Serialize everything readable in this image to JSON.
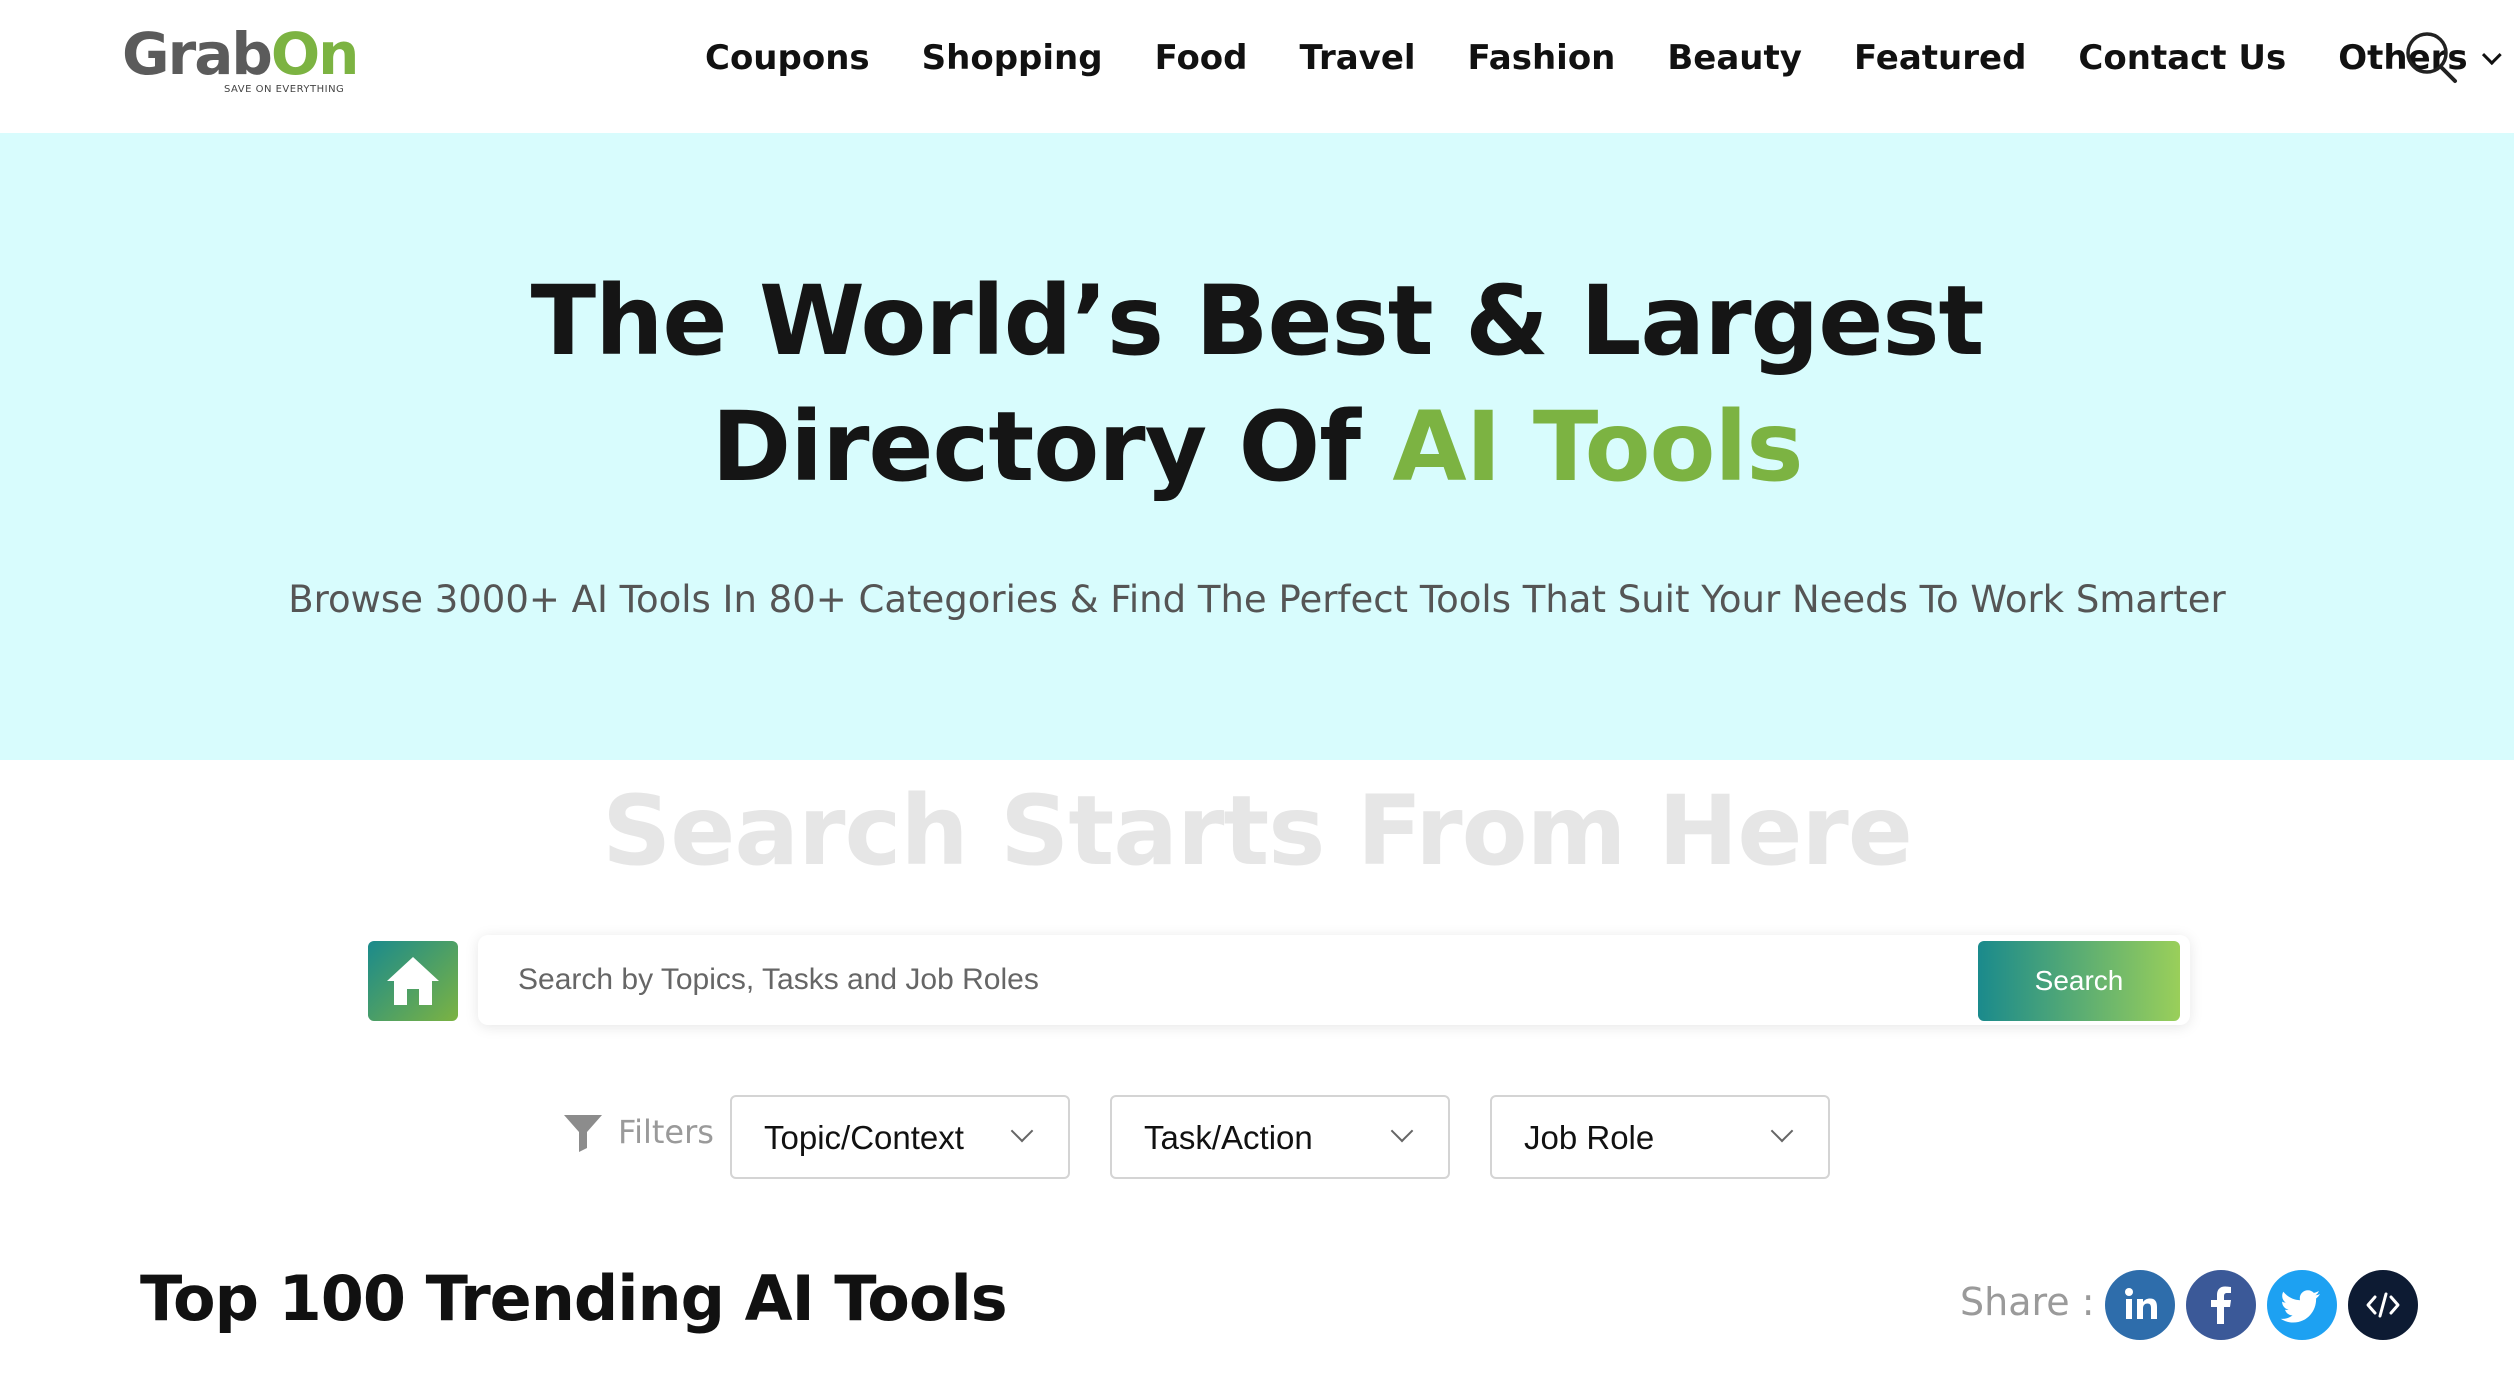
{
  "brand": {
    "logo_part1": "Grab",
    "logo_part2": "On",
    "tagline": "SAVE ON EVERYTHING"
  },
  "nav": {
    "items": [
      {
        "label": "Coupons"
      },
      {
        "label": "Shopping"
      },
      {
        "label": "Food"
      },
      {
        "label": "Travel"
      },
      {
        "label": "Fashion"
      },
      {
        "label": "Beauty"
      },
      {
        "label": "Featured"
      },
      {
        "label": "Contact Us"
      },
      {
        "label": "Others"
      }
    ]
  },
  "hero": {
    "title_line1": "The World’s Best & Largest",
    "title_line2_prefix": "Directory Of ",
    "title_line2_accent": "AI Tools",
    "subtitle": "Browse 3000+ AI Tools In 80+ Categories & Find The Perfect Tools That Suit Your Needs To Work Smarter"
  },
  "search": {
    "watermark": "Search Starts From Here",
    "placeholder": "Search by Topics, Tasks and Job Roles",
    "button_label": "Search"
  },
  "filters": {
    "label": "Filters",
    "selects": [
      {
        "label": "Topic/Context"
      },
      {
        "label": "Task/Action"
      },
      {
        "label": "Job Role"
      }
    ]
  },
  "trending": {
    "title": "Top 100 Trending AI Tools"
  },
  "share": {
    "label": "Share :",
    "buttons": [
      {
        "icon": "linkedin-icon",
        "color": "#2e6dab"
      },
      {
        "icon": "facebook-icon",
        "color": "#3b5998"
      },
      {
        "icon": "twitter-icon",
        "color": "#1da1f2"
      },
      {
        "icon": "embed-icon",
        "color": "#0d1b33"
      }
    ]
  },
  "colors": {
    "accent_green": "#7cb342",
    "hero_bg": "#d8fcfd",
    "teal": "#1a8a8c"
  }
}
